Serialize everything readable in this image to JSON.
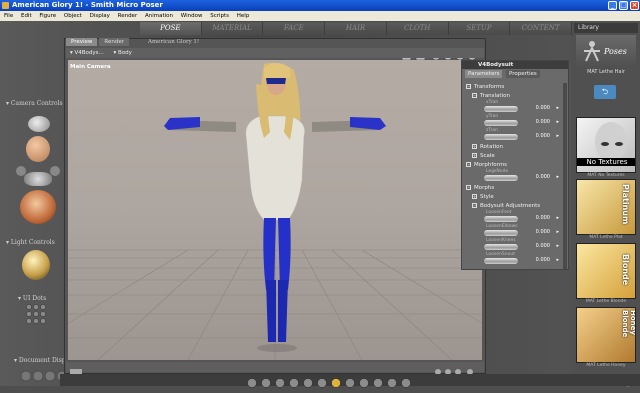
{
  "window": {
    "title": "American Glory 1! - Smith Micro Poser",
    "minimize": "_",
    "maximize": "□",
    "close": "×"
  },
  "menu": [
    "File",
    "Edit",
    "Figure",
    "Object",
    "Display",
    "Render",
    "Animation",
    "Window",
    "Scripts",
    "Help"
  ],
  "room_tabs": [
    "POSE",
    "MATERIAL",
    "FACE",
    "HAIR",
    "CLOTH",
    "SETUP",
    "CONTENT"
  ],
  "active_room": "POSE",
  "left_panel": {
    "camera_controls": "Camera Controls",
    "light_controls": "Light Controls",
    "ui_dots": "UI Dots",
    "document_display": "Document Disp"
  },
  "viewport": {
    "tabs": [
      "Preview",
      "Render"
    ],
    "document_title": "American Glory 1!",
    "figure_select": "V4Bodys...",
    "actor_select": "Body",
    "camera_label": "Main Camera"
  },
  "parameters": {
    "title": "V4Bodysuit",
    "tabs": [
      "Parameters",
      "Properties"
    ],
    "groups": [
      {
        "label": "Transforms",
        "kind": "group"
      },
      {
        "label": "Translation",
        "kind": "subgroup"
      },
      {
        "label": "xTran",
        "kind": "dial",
        "value": "0.000"
      },
      {
        "label": "yTran",
        "kind": "dial",
        "value": "0.000"
      },
      {
        "label": "zTran",
        "kind": "dial",
        "value": "0.000"
      },
      {
        "label": "Rotation",
        "kind": "subgroup"
      },
      {
        "label": "Scale",
        "kind": "subgroup"
      },
      {
        "label": "Morphforms",
        "kind": "group"
      },
      {
        "label": "LegsNude",
        "kind": "dial",
        "value": "0.000"
      },
      {
        "label": "Morphs",
        "kind": "group"
      },
      {
        "label": "Style",
        "kind": "subgroup"
      },
      {
        "label": "Bodysuit Adjustments",
        "kind": "subgroup"
      },
      {
        "label": "LoosenFeet",
        "kind": "dial",
        "value": "0.000"
      },
      {
        "label": "LoosenElbows",
        "kind": "dial",
        "value": "0.000"
      },
      {
        "label": "LoosenKnees",
        "kind": "dial",
        "value": "0.000"
      },
      {
        "label": "LoosenSnout",
        "kind": "dial",
        "value": "0.000"
      }
    ]
  },
  "library": {
    "title": "Library",
    "category": "Poses",
    "folder": "MAT Lethe Hair",
    "items": [
      {
        "label": "No Textures",
        "caption": "MAT No Textures"
      },
      {
        "label": "Platinum",
        "caption": "MAT Lethe Plat"
      },
      {
        "label": "Blonde",
        "caption": "MAT Lethe Blonde"
      },
      {
        "label": "Honey Blonde",
        "caption": "MAT Lethe Honey"
      }
    ]
  }
}
